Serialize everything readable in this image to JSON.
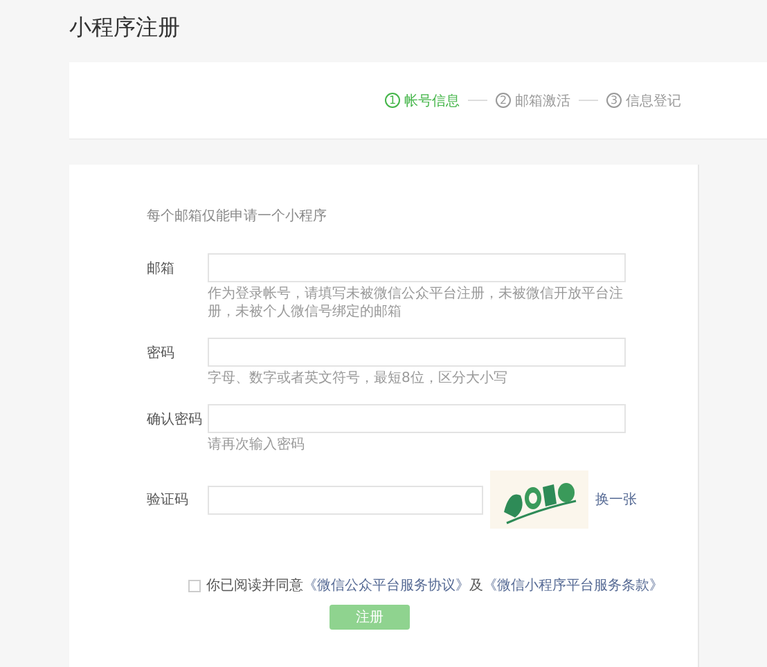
{
  "page_title": "小程序注册",
  "steps": [
    {
      "number": "1",
      "label": "帐号信息",
      "selected": true
    },
    {
      "number": "2",
      "label": "邮箱激活",
      "selected": false
    },
    {
      "number": "3",
      "label": "信息登记",
      "selected": false
    }
  ],
  "intro": "每个邮箱仅能申请一个小程序",
  "fields": [
    {
      "kind": "text",
      "label": "邮箱",
      "hint": "作为登录帐号，请填写未被微信公众平台注册，未被微信开放平台注册，未被个人微信号绑定的邮箱"
    },
    {
      "kind": "text",
      "label": "密码",
      "hint": "字母、数字或者英文符号，最短8位，区分大小写"
    },
    {
      "kind": "text",
      "label": "确认密码",
      "hint": "请再次输入密码"
    },
    {
      "kind": "captcha",
      "label": "验证码",
      "refresh": "换一张"
    }
  ],
  "agreement": {
    "checked": false,
    "prefix": "你已阅读并同意",
    "link1": "《微信公众平台服务协议》",
    "joiner": "及",
    "link2": "《微信小程序平台服务条款》"
  },
  "submit": {
    "label": "注册",
    "disabled": true
  }
}
